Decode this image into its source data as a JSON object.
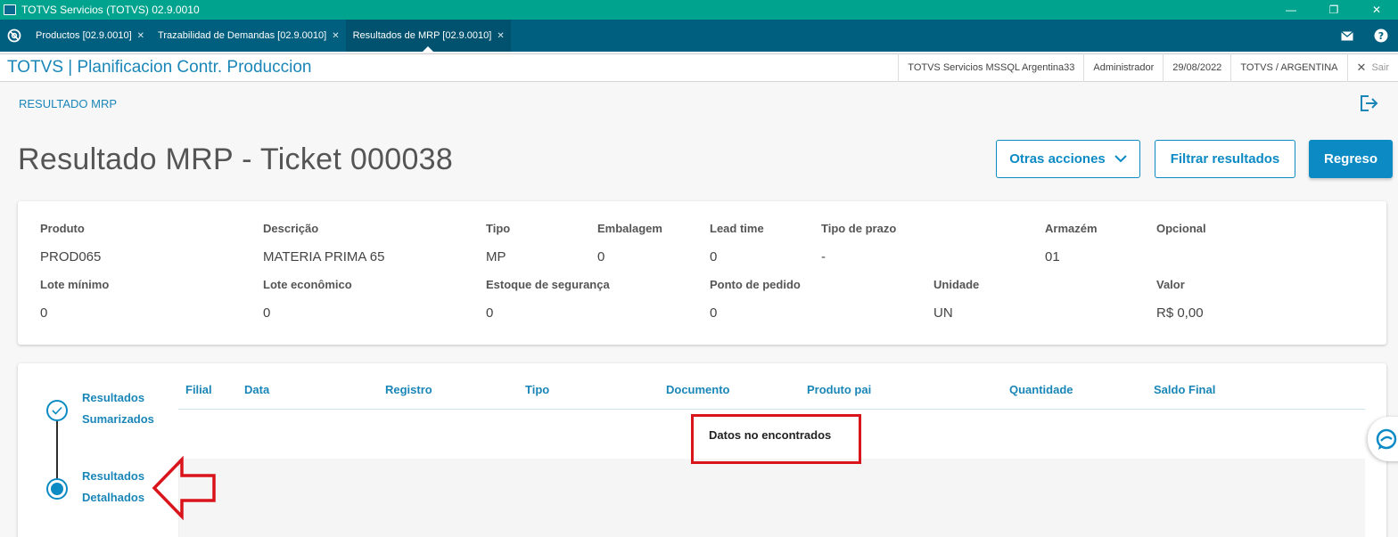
{
  "window": {
    "title": "TOTVS Servicios (TOTVS) 02.9.0010",
    "controls": [
      "—",
      "❐",
      "✕"
    ]
  },
  "tabs": [
    {
      "label": "Productos [02.9.0010]",
      "active": false
    },
    {
      "label": "Trazabilidad de Demandas [02.9.0010]",
      "active": false
    },
    {
      "label": "Resultados de MRP [02.9.0010]",
      "active": true
    }
  ],
  "header": {
    "app_title": "TOTVS | Planificacion Contr. Produccion",
    "server": "TOTVS Servicios MSSQL Argentina33",
    "user": "Administrador",
    "date": "29/08/2022",
    "company": "TOTVS / ARGENTINA",
    "exit": "Sair"
  },
  "page": {
    "breadcrumb": "RESULTADO MRP",
    "title": "Resultado MRP - Ticket 000038",
    "buttons": {
      "otras": "Otras acciones",
      "filtrar": "Filtrar resultados",
      "regreso": "Regreso"
    }
  },
  "product": {
    "produto_label": "Produto",
    "produto": "PROD065",
    "descricao_label": "Descrição",
    "descricao": "MATERIA PRIMA 65",
    "tipo_label": "Tipo",
    "tipo": "MP",
    "embalagem_label": "Embalagem",
    "embalagem": "0",
    "lead_label": "Lead time",
    "lead": "0",
    "prazo_label": "Tipo de prazo",
    "prazo": "-",
    "armazem_label": "Armazém",
    "armazem": "01",
    "opcional_label": "Opcional",
    "opcional": "",
    "lote_min_label": "Lote mínimo",
    "lote_min": "0",
    "lote_eco_label": "Lote econômico",
    "lote_eco": "0",
    "estoque_label": "Estoque de segurança",
    "estoque": "0",
    "ponto_label": "Ponto de pedido",
    "ponto": "0",
    "unidade_label": "Unidade",
    "unidade": "UN",
    "valor_label": "Valor",
    "valor": "R$ 0,00"
  },
  "stepper": {
    "step1_line1": "Resultados",
    "step1_line2": "Sumarizados",
    "step2_line1": "Resultados",
    "step2_line2": "Detalhados"
  },
  "table": {
    "columns": [
      "Filial",
      "Data",
      "Registro",
      "Tipo",
      "Documento",
      "Produto pai",
      "Quantidade",
      "Saldo Final"
    ],
    "empty": "Datos no encontrados"
  },
  "colors": {
    "primary": "#0c8ac4",
    "titlebar": "#00a38d",
    "tabbar": "#005f7f",
    "annotation": "#d9141b"
  }
}
